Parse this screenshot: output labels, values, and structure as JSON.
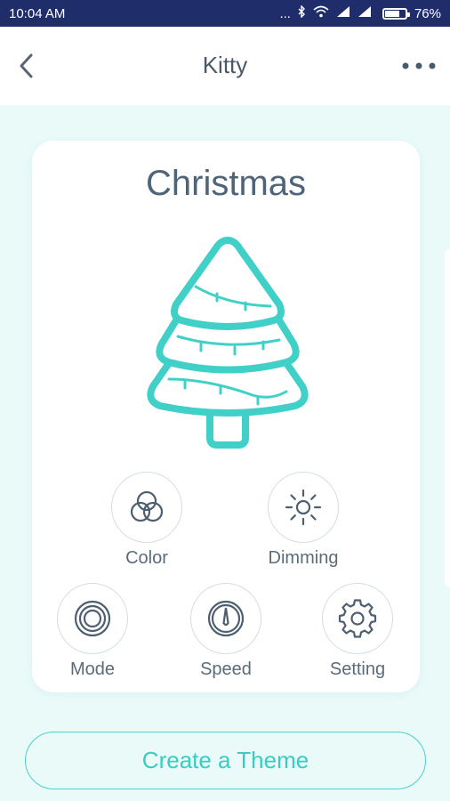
{
  "status_bar": {
    "time": "10:04 AM",
    "dots": "...",
    "battery": "76%",
    "battery_level": 0.76
  },
  "header": {
    "title": "Kitty"
  },
  "card": {
    "theme_name": "Christmas",
    "controls": [
      {
        "label": "Color",
        "icon": "color-circles-icon"
      },
      {
        "label": "Dimming",
        "icon": "sun-icon"
      },
      {
        "label": "Mode",
        "icon": "concentric-circles-icon"
      },
      {
        "label": "Speed",
        "icon": "speedometer-icon"
      },
      {
        "label": "Setting",
        "icon": "gear-icon"
      }
    ]
  },
  "create_button": {
    "label": "Create a Theme"
  },
  "colors": {
    "accent": "#41d0c8",
    "text": "#4e6478",
    "background": "#eafaf9",
    "status_bar": "#1f2d6b"
  }
}
